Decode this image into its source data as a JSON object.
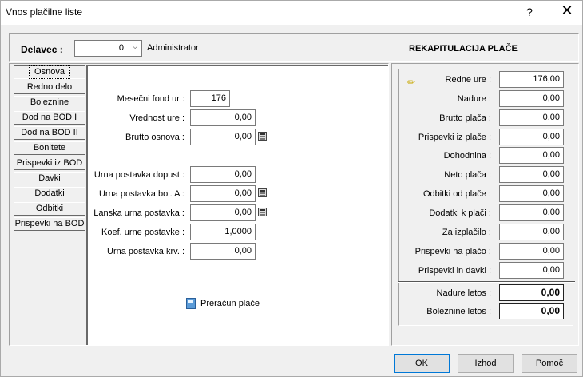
{
  "window": {
    "title": "Vnos plačilne liste",
    "help": "?",
    "close": "✕"
  },
  "header": {
    "delavec_label": "Delavec :",
    "delavec_value": "0",
    "delavec_name": "Administrator",
    "rekap_title": "REKAPITULACIJA PLAČE"
  },
  "nav": [
    "Osnova",
    "Redno delo",
    "Boleznine",
    "Dod na BOD I",
    "Dod na BOD II",
    "Bonitete",
    "Prispevki iz BOD",
    "Davki",
    "Dodatki",
    "Odbitki",
    "Prispevki na BOD"
  ],
  "nav_active": "Osnova",
  "osnova": {
    "fields": [
      {
        "label": "Mesečni fond ur :",
        "value": "176"
      },
      {
        "label": "Vrednost ure :",
        "value": "0,00"
      },
      {
        "label": "Brutto osnova :",
        "value": "0,00"
      },
      {
        "label": "Urna postavka dopust :",
        "value": "0,00"
      },
      {
        "label": "Urna postavka bol. A :",
        "value": "0,00"
      },
      {
        "label": "Lanska urna postavka :",
        "value": "0,00"
      },
      {
        "label": "Koef. urne postavke :",
        "value": "1,0000"
      },
      {
        "label": "Urna postavka krv. :",
        "value": "0,00"
      }
    ],
    "preracun_label": "Preračun plače"
  },
  "rekap": {
    "rows": [
      {
        "label": "Redne ure :",
        "value": "176,00"
      },
      {
        "label": "Nadure :",
        "value": "0,00"
      },
      {
        "label": "Brutto plača :",
        "value": "0,00"
      },
      {
        "label": "Prispevki iz plače :",
        "value": "0,00"
      },
      {
        "label": "Dohodnina :",
        "value": "0,00"
      },
      {
        "label": "Neto plača :",
        "value": "0,00"
      },
      {
        "label": "Odbitki od plače :",
        "value": "0,00"
      },
      {
        "label": "Dodatki k plači :",
        "value": "0,00"
      },
      {
        "label": "Za izplačilo :",
        "value": "0,00"
      },
      {
        "label": "Prispevki na plačo :",
        "value": "0,00"
      },
      {
        "label": "Prispevki in davki :",
        "value": "0,00"
      }
    ],
    "totals": [
      {
        "label": "Nadure letos :",
        "value": "0,00"
      },
      {
        "label": "Boleznine letos :",
        "value": "0,00"
      }
    ]
  },
  "buttons": {
    "ok": "OK",
    "izhod": "Izhod",
    "pomoc": "Pomoč"
  }
}
